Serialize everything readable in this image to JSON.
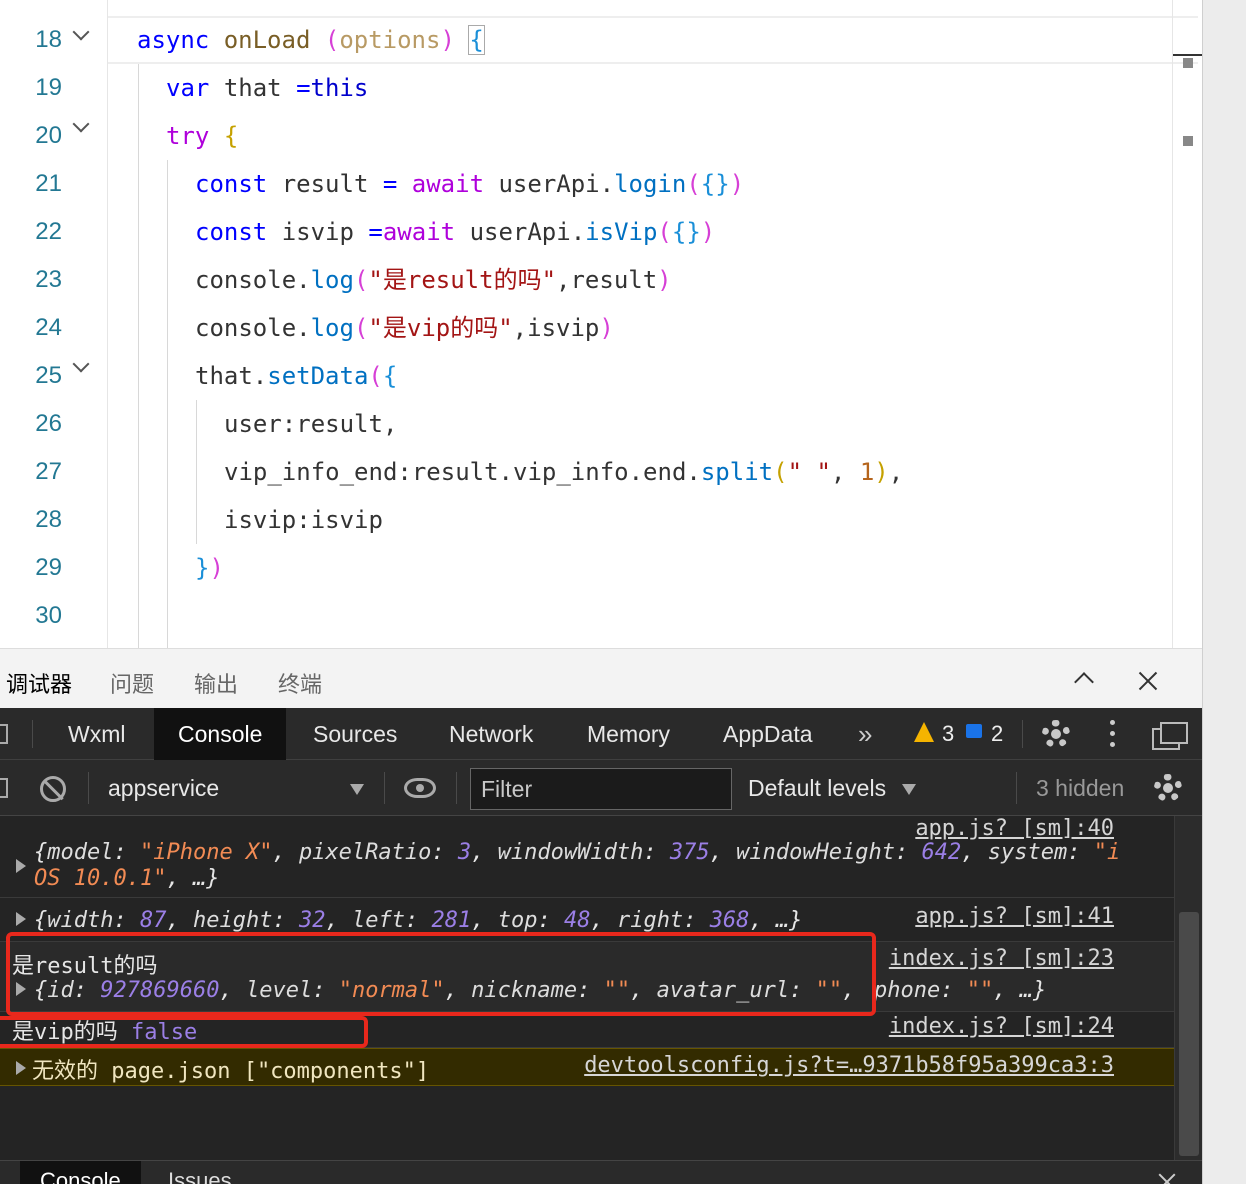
{
  "editor": {
    "line_numbers": [
      "18",
      "19",
      "20",
      "21",
      "22",
      "23",
      "24",
      "25",
      "26",
      "27",
      "28",
      "29",
      "30"
    ],
    "code": {
      "l18": {
        "kw": "async",
        "fn": "onLoad",
        "param": "options",
        "open": "("
      },
      "l19": {
        "var": "var",
        "name": "that",
        "assign": "=",
        "this": "this"
      },
      "l20": {
        "try": "try"
      },
      "l21": {
        "const": "const",
        "name": "result",
        "eq": "=",
        "await": "await",
        "obj": "userApi",
        "method": "login"
      },
      "l22": {
        "const": "const",
        "name": "isvip",
        "eq": "=",
        "await": "await",
        "obj": "userApi",
        "method": "isVip"
      },
      "l23": {
        "obj": "console",
        "method": "log",
        "str": "\"是result的吗\"",
        "arg": "result"
      },
      "l24": {
        "obj": "console",
        "method": "log",
        "str": "\"是vip的吗\"",
        "arg": "isvip"
      },
      "l25": {
        "obj": "that",
        "method": "setData"
      },
      "l26": {
        "key": "user",
        "val": "result"
      },
      "l27": {
        "key": "vip_info_end",
        "a": "result",
        "b": "vip_info",
        "c": "end",
        "method": "split",
        "str": "\" \"",
        "num": "1"
      },
      "l28": {
        "key": "isvip",
        "val": "isvip"
      }
    }
  },
  "panel_tabs": [
    "调试器",
    "问题",
    "输出",
    "终端"
  ],
  "devtools": {
    "tabs": [
      "Wxml",
      "Console",
      "Sources",
      "Network",
      "Memory",
      "AppData"
    ],
    "active_tab": "Console",
    "more_glyph": "»",
    "warnings": "3",
    "messages": "2"
  },
  "console_toolbar": {
    "context": "appservice",
    "filter_placeholder": "Filter",
    "levels": "Default levels",
    "hidden": "3 hidden"
  },
  "console": {
    "rows": [
      {
        "source": "app.js? [sm]:40",
        "line1": {
          "open": "{",
          "k1": "model",
          "v1": "\"iPhone X\"",
          "k2": "pixelRatio",
          "v2": "3",
          "k3": "windowWidth",
          "v3": "375",
          "k4": "windowHeight",
          "v4": "642",
          "k5": "system",
          "v5a": "\"i"
        },
        "line2": {
          "v5b": "OS 10.0.1\"",
          "tail": ", …}"
        }
      },
      {
        "source": "app.js? [sm]:41",
        "text": {
          "open": "{",
          "k1": "width",
          "v1": "87",
          "k2": "height",
          "v2": "32",
          "k3": "left",
          "v3": "281",
          "k4": "top",
          "v4": "48",
          "k5": "right",
          "v5": "368",
          "tail": ", …}"
        }
      },
      {
        "source": "index.js? [sm]:23",
        "label": "是result的吗",
        "obj": {
          "open": "{",
          "k1": "id",
          "v1": "927869660",
          "k2": "level",
          "v2": "\"normal\"",
          "k3": "nickname",
          "v3": "\"\"",
          "k4": "avatar_url",
          "v4": "\"\"",
          "tail_key": "phone",
          "tail_val": "\"\"",
          "tail": ", …}"
        }
      },
      {
        "source": "index.js? [sm]:24",
        "label": "是vip的吗",
        "value": "false"
      },
      {
        "source": "devtoolsconfig.js?t=…9371b58f95a399ca3:3",
        "text": "无效的 page.json [\"components\"]"
      }
    ]
  },
  "drawer_tabs": [
    "Console",
    "Issues"
  ],
  "colors": {
    "highlight": "#e8281c",
    "warning_bg": "#332b00",
    "accent": "#1a73e8"
  }
}
